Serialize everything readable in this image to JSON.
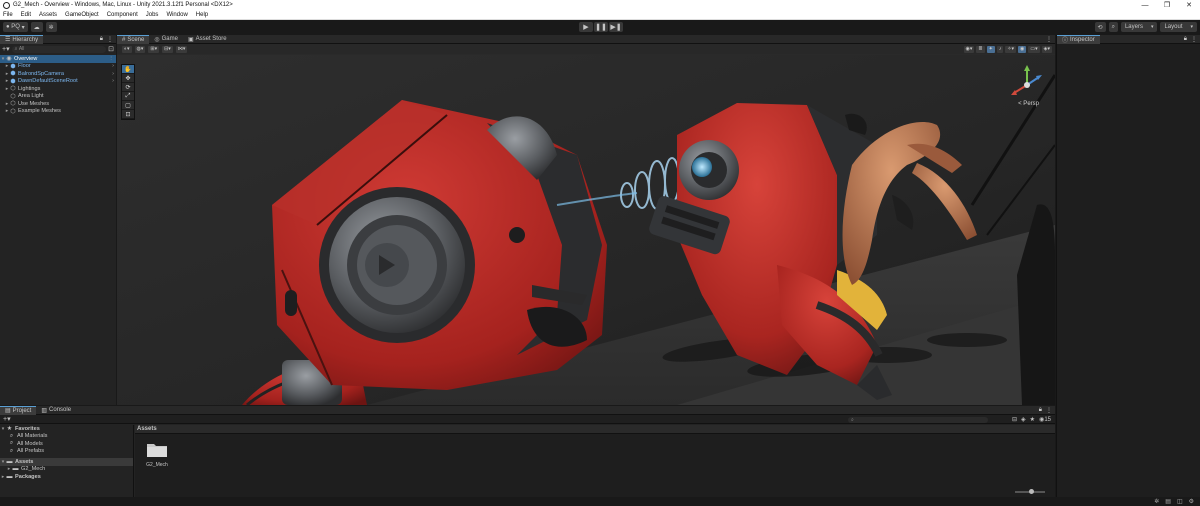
{
  "window": {
    "title": "G2_Mech - Overview - Windows, Mac, Linux - Unity 2021.3.12f1 Personal <DX12>",
    "minimize": "—",
    "maximize": "❐",
    "close": "✕"
  },
  "menu": [
    "File",
    "Edit",
    "Assets",
    "GameObject",
    "Component",
    "Jobs",
    "Window",
    "Help"
  ],
  "toolbar": {
    "account": "PQ",
    "play": "▶",
    "pause": "❚❚",
    "step": "▶❚",
    "layers": "Layers",
    "layout": "Layout"
  },
  "hierarchy": {
    "tab": "Hierarchy",
    "search_placeholder": "All",
    "items": [
      {
        "label": "Overview",
        "icon": "unity-scene-icon",
        "selected": true
      },
      {
        "label": "Floor"
      },
      {
        "label": "BalrondSpCamera"
      },
      {
        "label": "DawnDefaultSceneRoot"
      },
      {
        "label": "Lightings"
      },
      {
        "label": "Area Light"
      },
      {
        "label": "Use Meshes"
      },
      {
        "label": "Example Meshes"
      }
    ]
  },
  "scene": {
    "tabs": [
      "Scene",
      "Game",
      "Asset Store"
    ],
    "active_tab": "Scene",
    "persp_label": "< Persp",
    "tools": [
      "view-tool",
      "move-tool",
      "rotate-tool",
      "scale-tool",
      "rect-tool",
      "transform-tool"
    ]
  },
  "inspector": {
    "tab": "Inspector"
  },
  "project": {
    "tabs": [
      "Project",
      "Console"
    ],
    "active_tab": "Project",
    "favorites": {
      "label": "Favorites",
      "items": [
        "All Materials",
        "All Models",
        "All Prefabs"
      ]
    },
    "assets_label": "Assets",
    "assets_children": [
      "G2_Mech"
    ],
    "packages_label": "Packages",
    "breadcrumb": "Assets",
    "folder_tiles": [
      "G2_Mech"
    ],
    "hidden_count": "15"
  },
  "colors": {
    "editor_bg": "#191919",
    "selection_blue": "#2c5d87",
    "accent_blue": "#7cb6ee",
    "mech_red": "#b92622"
  }
}
